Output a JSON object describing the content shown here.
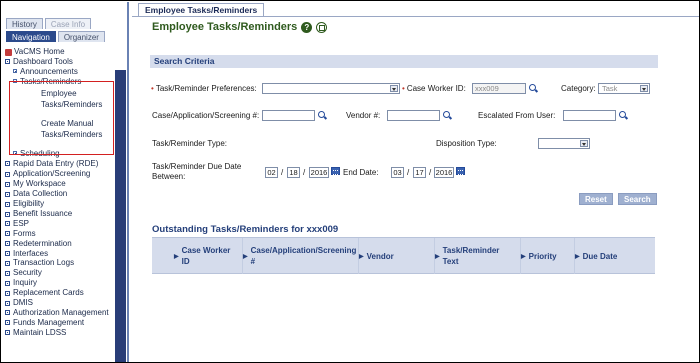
{
  "sidebar": {
    "tabs_top": [
      "History",
      "Case Info"
    ],
    "tabs_bottom": [
      "Navigation",
      "Organizer"
    ],
    "items": [
      {
        "label": "VaCMS Home"
      },
      {
        "label": "Dashboard Tools"
      },
      {
        "label": "Announcements"
      },
      {
        "label": "Tasks/Reminders"
      },
      {
        "label": "Employee Tasks/Reminders"
      },
      {
        "label": "Create Manual Tasks/Reminders"
      },
      {
        "label": "Scheduling"
      },
      {
        "label": "Rapid Data Entry (RDE)"
      },
      {
        "label": "Application/Screening"
      },
      {
        "label": "My Workspace"
      },
      {
        "label": "Data Collection"
      },
      {
        "label": "Eligibility"
      },
      {
        "label": "Benefit Issuance"
      },
      {
        "label": "ESP"
      },
      {
        "label": "Forms"
      },
      {
        "label": "Redetermination"
      },
      {
        "label": "Interfaces"
      },
      {
        "label": "Transaction Logs"
      },
      {
        "label": "Security"
      },
      {
        "label": "Inquiry"
      },
      {
        "label": "Replacement Cards"
      },
      {
        "label": "DMIS"
      },
      {
        "label": "Authorization Management"
      },
      {
        "label": "Funds Management"
      },
      {
        "label": "Maintain LDSS"
      }
    ]
  },
  "main": {
    "tab_label": "Employee Tasks/Reminders",
    "page_title": "Employee Tasks/Reminders",
    "search_section_title": "Search Criteria",
    "fields": {
      "preferences_label": "Task/Reminder Preferences:",
      "case_worker_label": "Case Worker ID:",
      "case_worker_value": "xxx009",
      "category_label": "Category:",
      "category_value": "Task",
      "case_app_label": "Case/Application/Screening #:",
      "vendor_label": "Vendor #:",
      "escalated_label": "Escalated From User:",
      "type_label": "Task/Reminder Type:",
      "disposition_label": "Disposition Type:",
      "due_date_label_1": "Task/Reminder Due Date",
      "due_date_label_2": "Between:",
      "start_month": "02",
      "start_day": "18",
      "start_year": "2016",
      "end_label": "End Date:",
      "end_month": "03",
      "end_day": "17",
      "end_year": "2016",
      "date_separator": "/"
    },
    "buttons": {
      "reset": "Reset",
      "search": "Search"
    },
    "results_title": "Outstanding Tasks/Reminders for xxx009",
    "columns": [
      {
        "label": "Case Worker ID"
      },
      {
        "label": "Case/Application/Screening #"
      },
      {
        "label": "Vendor"
      },
      {
        "label": "Task/Reminder Text"
      },
      {
        "label": "Priority"
      },
      {
        "label": "Due Date"
      }
    ],
    "colors": {
      "title_green": "#2f5a1e",
      "nav_blue": "#2b4a8c",
      "section_bg": "#d5dcec",
      "highlight_red": "#d32020"
    }
  }
}
